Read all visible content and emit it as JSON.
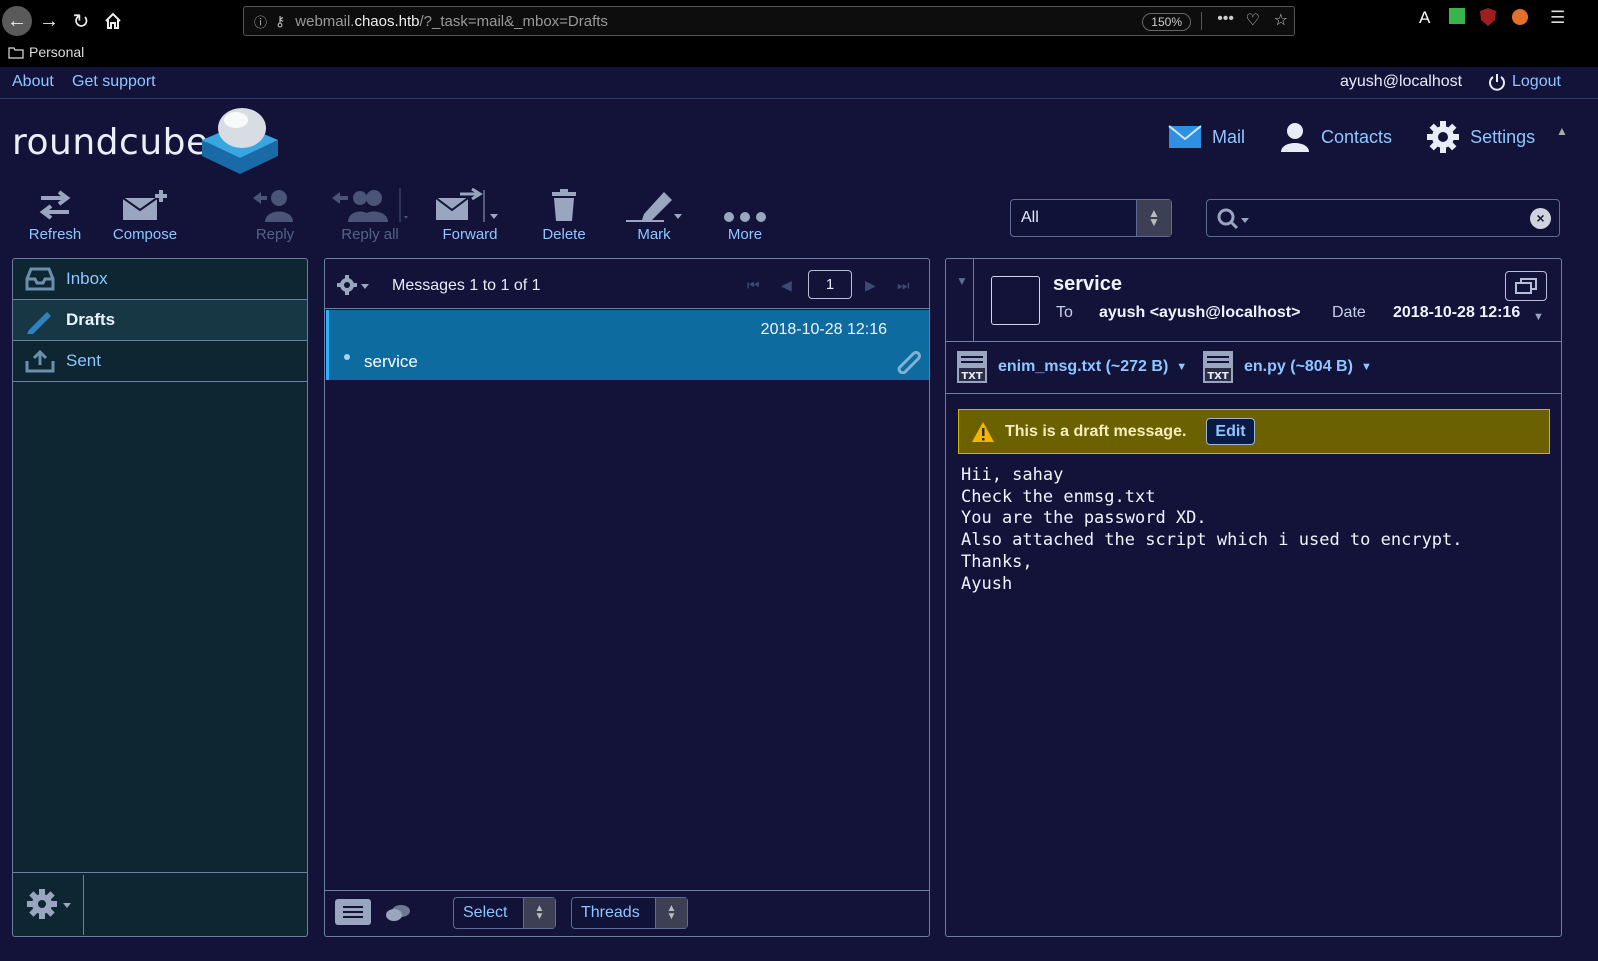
{
  "browser": {
    "url_prefix": "webmail.",
    "url_domain": "chaos.htb",
    "url_path": "/?_task=mail&_mbox=Drafts",
    "zoom": "150%",
    "bookmark_folder": "Personal"
  },
  "topline": {
    "about": "About",
    "support": "Get support",
    "username": "ayush@localhost",
    "logout": "Logout"
  },
  "logo_text": "roundcube",
  "tasks": {
    "mail": "Mail",
    "contacts": "Contacts",
    "settings": "Settings"
  },
  "toolbar": {
    "refresh": "Refresh",
    "compose": "Compose",
    "reply": "Reply",
    "reply_all": "Reply all",
    "forward": "Forward",
    "delete": "Delete",
    "mark": "Mark",
    "more": "More"
  },
  "filter": {
    "selected": "All"
  },
  "search": {
    "placeholder": "",
    "value": ""
  },
  "folders": [
    {
      "label": "Inbox"
    },
    {
      "label": "Drafts"
    },
    {
      "label": "Sent"
    }
  ],
  "message_list": {
    "count_text": "Messages 1 to 1 of 1",
    "page": "1",
    "messages": [
      {
        "date": "2018-10-28 12:16",
        "subject": "service"
      }
    ],
    "select_label": "Select",
    "threads_label": "Threads"
  },
  "preview": {
    "subject": "service",
    "to_label": "To",
    "to_value": "ayush <ayush@localhost>",
    "date_label": "Date",
    "date_value": "2018-10-28 12:16",
    "attachments": [
      {
        "name": "enim_msg.txt (~272 B)"
      },
      {
        "name": "en.py (~804 B)"
      }
    ],
    "draft_notice": "This is a draft message.",
    "edit_label": "Edit",
    "body": "Hii, sahay\nCheck the enmsg.txt\nYou are the password XD.\nAlso attached the script which i used to encrypt.\nThanks,\nAyush"
  },
  "colors": {
    "background": "#13133a",
    "link": "#8fc6ff",
    "selected_row": "#0d6b9f",
    "draft_bar": "#6c6100"
  }
}
